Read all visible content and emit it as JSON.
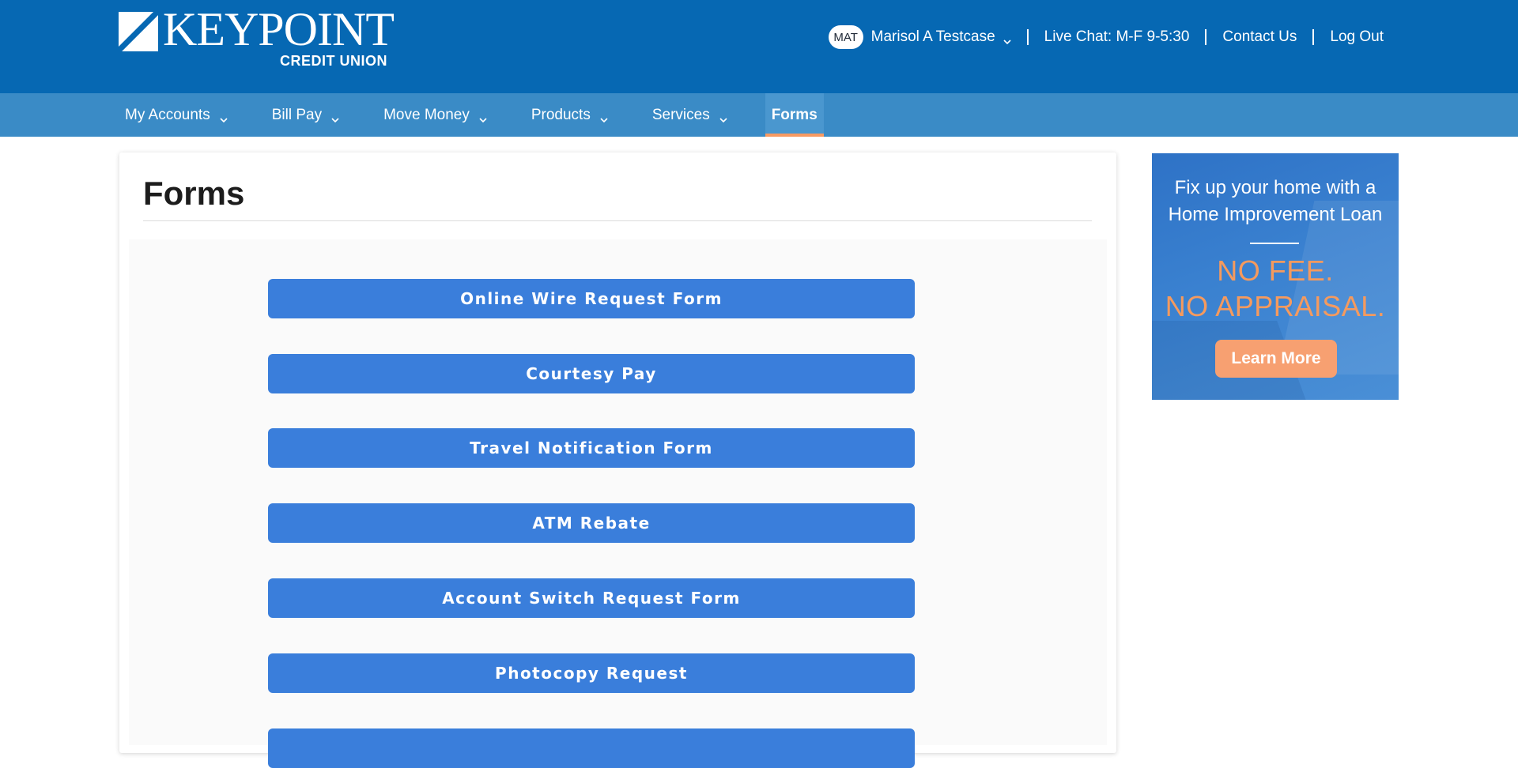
{
  "brand": {
    "name": "KEYPOINT",
    "sub": "CREDIT UNION",
    "colors": {
      "header": "#0668b3",
      "nav": "#3a8bc6",
      "button": "#3a7edb",
      "accent": "#f79a62"
    }
  },
  "user": {
    "initials": "MAT",
    "name": "Marisol A Testcase"
  },
  "header_links": {
    "live_chat": "Live Chat: M-F 9-5:30",
    "contact": "Contact Us",
    "logout": "Log Out"
  },
  "nav": {
    "items": [
      {
        "label": "My Accounts",
        "dropdown": true
      },
      {
        "label": "Bill Pay",
        "dropdown": true
      },
      {
        "label": "Move Money",
        "dropdown": true
      },
      {
        "label": "Products",
        "dropdown": true
      },
      {
        "label": "Services",
        "dropdown": true
      },
      {
        "label": "Forms",
        "dropdown": false,
        "active": true
      }
    ]
  },
  "page": {
    "title": "Forms"
  },
  "forms": [
    "Online Wire Request Form",
    "Courtesy Pay",
    "Travel Notification Form",
    "ATM Rebate",
    "Account Switch Request Form",
    "Photocopy Request"
  ],
  "ad": {
    "line1": "Fix up your home with a",
    "line2": "Home Improvement Loan",
    "offer1": "NO FEE.",
    "offer2": "NO APPRAISAL.",
    "cta": "Learn More"
  },
  "icons": {
    "chevron": "chevron-down-icon",
    "logo": "keypoint-logo-mark"
  }
}
